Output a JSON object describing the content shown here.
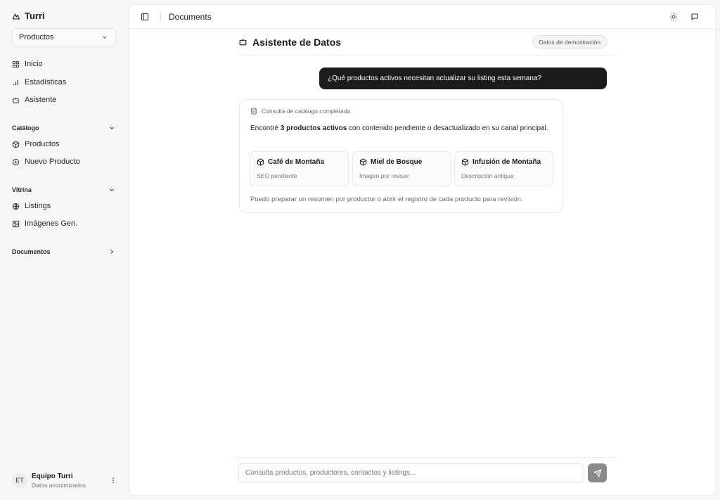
{
  "app": {
    "name": "Turri"
  },
  "sidebar": {
    "selector": {
      "value": "Productos"
    },
    "nav": [
      {
        "label": "Inicio",
        "icon": "grid-icon"
      },
      {
        "label": "Estadísticas",
        "icon": "bar-chart-icon"
      },
      {
        "label": "Asistente",
        "icon": "bot-icon"
      }
    ],
    "groups": {
      "catalogo": {
        "title": "Catálogo",
        "items": [
          {
            "label": "Productos",
            "icon": "package-icon"
          },
          {
            "label": "Nuevo Producto",
            "icon": "plus-circle-icon"
          }
        ]
      },
      "vitrina": {
        "title": "Vitrina",
        "items": [
          {
            "label": "Listings",
            "icon": "globe-icon"
          },
          {
            "label": "Imágenes Gen.",
            "icon": "image-icon"
          }
        ]
      },
      "documentos": {
        "title": "Documentos"
      }
    },
    "user": {
      "initials": "ET",
      "name": "Equipo Turri",
      "subtitle": "Datos anonimizados"
    }
  },
  "topbar": {
    "title": "Documents"
  },
  "assistant": {
    "title": "Asistente de Datos",
    "badge": "Datos de demostración",
    "user_message": "¿Qué productos activos necesitan actualizar su listing esta semana?",
    "response": {
      "status": "Consulta de catálogo completada",
      "intro_before": "Encontré ",
      "intro_bold": "3 productos activos",
      "intro_after": " con contenido pendiente o desactualizado en su canal principal.",
      "products": [
        {
          "name": "Café de Montaña",
          "note": "SEO pendiente"
        },
        {
          "name": "Miel de Bosque",
          "note": "Imagen por revisar"
        },
        {
          "name": "Infusión de Montaña",
          "note": "Descripción antigua"
        }
      ],
      "footer": "Puedo preparar un resumen por productor o abrir el registro de cada producto para revisión."
    },
    "input": {
      "placeholder": "Consulta productos, productores, contactos y listings...",
      "value": ""
    }
  }
}
